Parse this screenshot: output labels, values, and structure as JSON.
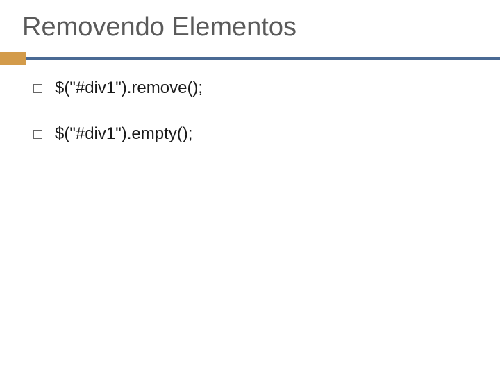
{
  "slide": {
    "title": "Removendo Elementos",
    "bullets": [
      {
        "text": "$(\"#div1\").remove();"
      },
      {
        "text": "$(\"#div1\").empty();"
      }
    ]
  }
}
